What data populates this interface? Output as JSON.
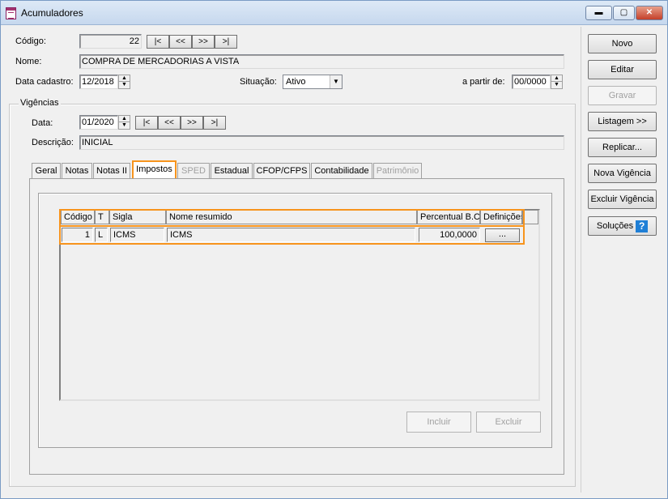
{
  "window": {
    "title": "Acumuladores"
  },
  "fields": {
    "codigo_label": "Código:",
    "codigo_value": "22",
    "nome_label": "Nome:",
    "nome_value": "COMPRA DE MERCADORIAS A VISTA",
    "data_cadastro_label": "Data cadastro:",
    "data_cadastro_value": "12/2018",
    "situacao_label": "Situação:",
    "situacao_value": "Ativo",
    "a_partir_label": "a partir de:",
    "a_partir_value": "00/0000"
  },
  "nav_buttons": [
    "|<",
    "<<",
    ">>",
    ">|"
  ],
  "vigencias": {
    "group_label": "Vigências",
    "data_label": "Data:",
    "data_value": "01/2020",
    "descricao_label": "Descrição:",
    "descricao_value": "INICIAL"
  },
  "tabs": [
    {
      "label": "Geral",
      "state": "normal"
    },
    {
      "label": "Notas",
      "state": "normal"
    },
    {
      "label": "Notas II",
      "state": "normal"
    },
    {
      "label": "Impostos",
      "state": "active"
    },
    {
      "label": "SPED",
      "state": "disabled"
    },
    {
      "label": "Estadual",
      "state": "normal"
    },
    {
      "label": "CFOP/CFPS",
      "state": "normal"
    },
    {
      "label": "Contabilidade",
      "state": "normal"
    },
    {
      "label": "Patrimônio",
      "state": "disabled"
    }
  ],
  "grid": {
    "headers": [
      "Código",
      "T",
      "Sigla",
      "Nome resumido",
      "Percentual B.C.",
      "Definições"
    ],
    "rows": [
      {
        "codigo": "1",
        "t": "L",
        "sigla": "ICMS",
        "nome": "ICMS",
        "percentual": "100,0000",
        "definicoes": "..."
      }
    ]
  },
  "grid_buttons": {
    "incluir": "Incluir",
    "excluir": "Excluir"
  },
  "side_buttons": {
    "novo": "Novo",
    "editar": "Editar",
    "gravar": "Gravar",
    "listagem": "Listagem >>",
    "replicar": "Replicar...",
    "nova_vigencia": "Nova Vigência",
    "excluir_vigencia": "Excluir Vigência",
    "solucoes": "Soluções"
  },
  "colors": {
    "highlight": "#f7941d",
    "titlebar": "#c6d8ee",
    "help": "#1f7fd6"
  },
  "icons": {
    "app": "document-icon",
    "help": "question-icon"
  }
}
